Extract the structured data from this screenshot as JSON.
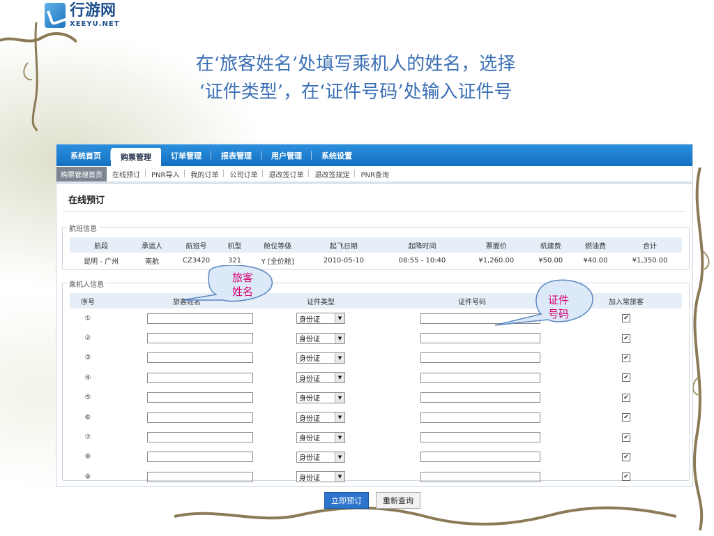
{
  "logo": {
    "cn": "行游网",
    "en": "XEEYU.NET"
  },
  "headline": {
    "line1": "在‘旅客姓名’处填写乘机人的姓名，选择",
    "line2": "‘证件类型’，在‘证件号码’处输入证件号"
  },
  "topnav": {
    "items": [
      {
        "label": "系统首页"
      },
      {
        "label": "购票管理"
      },
      {
        "label": "订单管理"
      },
      {
        "label": "报表管理"
      },
      {
        "label": "用户管理"
      },
      {
        "label": "系统设置"
      }
    ]
  },
  "subnav": {
    "items": [
      {
        "label": "购票管理首页"
      },
      {
        "label": "在线预订"
      },
      {
        "label": "PNR导入"
      },
      {
        "label": "我的订单"
      },
      {
        "label": "公司订单"
      },
      {
        "label": "退改签订单"
      },
      {
        "label": "退改签规定"
      },
      {
        "label": "PNR查询"
      }
    ]
  },
  "page_title": "在线预订",
  "flight": {
    "legend": "航班信息",
    "headers": [
      "航段",
      "承运人",
      "航班号",
      "机型",
      "舱位等级",
      "起飞日期",
      "起降时间",
      "票面价",
      "机建费",
      "燃油费",
      "合计"
    ],
    "row": [
      "昆明 - 广州",
      "南航",
      "CZ3420",
      "321",
      "Y [全价舱]",
      "2010-05-10",
      "08:55 - 10:40",
      "¥1,260.00",
      "¥50.00",
      "¥40.00",
      "¥1,350.00"
    ]
  },
  "passengers": {
    "legend": "乘机人信息",
    "headers": [
      "序号",
      "旅客姓名",
      "证件类型",
      "证件号码",
      "加入常旅客"
    ],
    "rows": [
      {
        "no": "①",
        "id_type": "身份证"
      },
      {
        "no": "②",
        "id_type": "身份证"
      },
      {
        "no": "③",
        "id_type": "身份证"
      },
      {
        "no": "④",
        "id_type": "身份证"
      },
      {
        "no": "⑤",
        "id_type": "身份证"
      },
      {
        "no": "⑥",
        "id_type": "身份证"
      },
      {
        "no": "⑦",
        "id_type": "身份证"
      },
      {
        "no": "⑧",
        "id_type": "身份证"
      },
      {
        "no": "⑨",
        "id_type": "身份证"
      }
    ],
    "check_mark": "✔"
  },
  "buttons": {
    "book": "立即预订",
    "requery": "重新查询"
  },
  "callouts": {
    "name": {
      "line1": "旅客",
      "line2": "姓名"
    },
    "idno": {
      "line1": "证件",
      "line2": "号码"
    }
  },
  "colors": {
    "nav_blue": "#1a7ad0",
    "headline": "#3a6fb4",
    "callout_text": "#d8006e"
  }
}
